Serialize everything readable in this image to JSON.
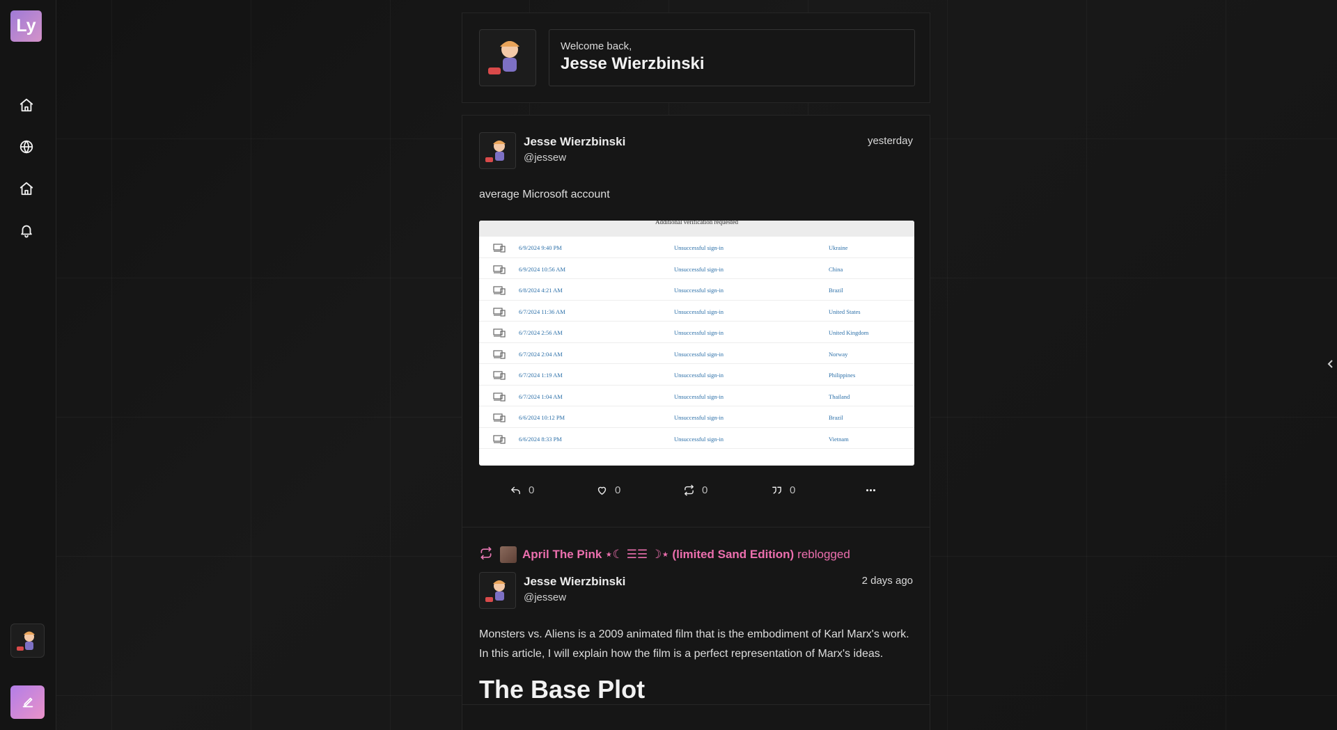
{
  "app": {
    "logo_text": "Ly"
  },
  "sidebar": {
    "items": [
      {
        "icon": "home-icon"
      },
      {
        "icon": "globe-icon"
      },
      {
        "icon": "home-icon"
      },
      {
        "icon": "bell-icon"
      }
    ],
    "compose_icon": "compose-icon"
  },
  "welcome": {
    "greeting": "Welcome back,",
    "name": "Jesse Wierzbinski"
  },
  "post1": {
    "author_name": "Jesse Wierzbinski",
    "author_handle": "@jessew",
    "time": "yesterday",
    "text": "average Microsoft account",
    "attachment": {
      "header": "Additional verification requested",
      "rows": [
        {
          "date": "6/9/2024 9:40 PM",
          "status": "Unsuccessful sign-in",
          "country": "Ukraine"
        },
        {
          "date": "6/9/2024 10:56 AM",
          "status": "Unsuccessful sign-in",
          "country": "China"
        },
        {
          "date": "6/8/2024 4:21 AM",
          "status": "Unsuccessful sign-in",
          "country": "Brazil"
        },
        {
          "date": "6/7/2024 11:36 AM",
          "status": "Unsuccessful sign-in",
          "country": "United States"
        },
        {
          "date": "6/7/2024 2:56 AM",
          "status": "Unsuccessful sign-in",
          "country": "United Kingdom"
        },
        {
          "date": "6/7/2024 2:04 AM",
          "status": "Unsuccessful sign-in",
          "country": "Norway"
        },
        {
          "date": "6/7/2024 1:19 AM",
          "status": "Unsuccessful sign-in",
          "country": "Philippines"
        },
        {
          "date": "6/7/2024 1:04 AM",
          "status": "Unsuccessful sign-in",
          "country": "Thailand"
        },
        {
          "date": "6/6/2024 10:12 PM",
          "status": "Unsuccessful sign-in",
          "country": "Brazil"
        },
        {
          "date": "6/6/2024 8:33 PM",
          "status": "Unsuccessful sign-in",
          "country": "Vietnam"
        }
      ]
    },
    "actions": {
      "reply_count": "0",
      "like_count": "0",
      "reblog_count": "0",
      "quote_count": "0"
    }
  },
  "post2": {
    "reblogger_name": "April The Pink ⋆☾ ☰☰ ☽⋆ (limited Sand Edition)",
    "reblogged_label": "reblogged",
    "author_name": "Jesse Wierzbinski",
    "author_handle": "@jessew",
    "time": "2 days ago",
    "text": "Monsters vs. Aliens is a 2009 animated film that is the embodiment of Karl Marx's work. In this article, I will explain how the film is a perfect representation of Marx's ideas.",
    "heading": "The Base Plot"
  },
  "colors": {
    "accent": "#ec6fae",
    "logo_gradient_start": "#9f7ad6",
    "logo_gradient_end": "#d493c9"
  }
}
